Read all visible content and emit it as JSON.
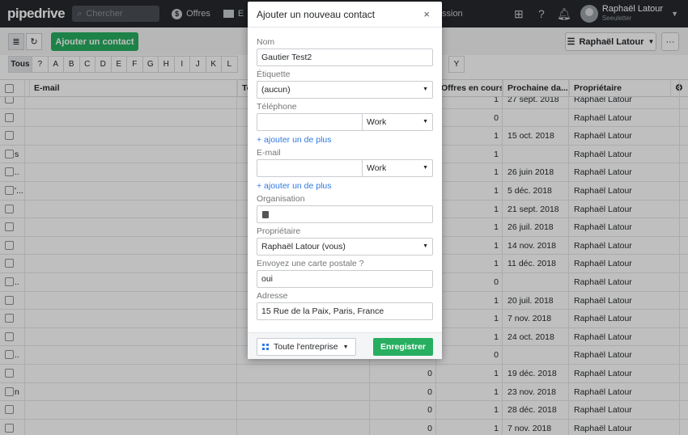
{
  "app": {
    "logo": "pipedrive",
    "search_placeholder": "Chercher",
    "nav_deals": "Offres",
    "nav_mail": "E",
    "nav_session": "ssion"
  },
  "user": {
    "name": "Raphaël Latour",
    "company": "Seeuletter"
  },
  "toolbar": {
    "add_contact": "Ajouter un contact",
    "owner_filter": "Raphaël Latour",
    "more": "···"
  },
  "alphabet": {
    "first": "Tous",
    "letters": [
      "?",
      "A",
      "B",
      "C",
      "D",
      "E",
      "F",
      "G",
      "H",
      "I",
      "J",
      "K",
      "L"
    ],
    "last": "Y"
  },
  "table": {
    "headers": {
      "email": "E-mail",
      "phone": "Te",
      "open_deals": "Offres en cours",
      "next_activity": "Prochaine da...",
      "owner": "Propriétaire"
    },
    "rows": [
      {
        "lead": "",
        "open": "1",
        "next": "27 sept. 2018",
        "owner": "Raphaël Latour"
      },
      {
        "lead": "",
        "open": "0",
        "next": "",
        "owner": "Raphaël Latour"
      },
      {
        "lead": "",
        "open": "1",
        "next": "15 oct. 2018",
        "owner": "Raphaël Latour"
      },
      {
        "lead": "s",
        "open": "1",
        "next": "",
        "owner": "Raphaël Latour"
      },
      {
        "lead": "..",
        "open": "1",
        "next": "26 juin 2018",
        "owner": "Raphaël Latour"
      },
      {
        "lead": "'...",
        "open": "1",
        "next": "5 déc. 2018",
        "owner": "Raphaël Latour"
      },
      {
        "lead": "",
        "open": "1",
        "next": "21 sept. 2018",
        "owner": "Raphaël Latour"
      },
      {
        "lead": "",
        "open": "1",
        "next": "26 juil. 2018",
        "owner": "Raphaël Latour"
      },
      {
        "lead": "",
        "open": "1",
        "next": "14 nov. 2018",
        "owner": "Raphaël Latour"
      },
      {
        "lead": "",
        "open": "1",
        "next": "11 déc. 2018",
        "owner": "Raphaël Latour"
      },
      {
        "lead": "..",
        "open": "0",
        "next": "",
        "owner": "Raphaël Latour"
      },
      {
        "lead": "",
        "open": "1",
        "next": "20 juil. 2018",
        "owner": "Raphaël Latour"
      },
      {
        "lead": "",
        "open": "1",
        "next": "7 nov. 2018",
        "owner": "Raphaël Latour"
      },
      {
        "lead": "",
        "open": "1",
        "next": "24 oct. 2018",
        "owner": "Raphaël Latour"
      },
      {
        "lead": "..",
        "open": "0",
        "next": "",
        "owner": "Raphaël Latour"
      },
      {
        "lead": "",
        "open": "1",
        "next": "19 déc. 2018",
        "owner": "Raphaël Latour"
      },
      {
        "lead": "n",
        "open": "1",
        "next": "23 nov. 2018",
        "owner": "Raphaël Latour"
      },
      {
        "lead": "",
        "open": "1",
        "next": "28 déc. 2018",
        "owner": "Raphaël Latour"
      },
      {
        "lead": "",
        "open": "1",
        "next": "7 nov. 2018",
        "owner": "Raphaël Latour"
      }
    ],
    "row_zero_col": "0"
  },
  "modal": {
    "title": "Ajouter un nouveau contact",
    "close": "×",
    "name_label": "Nom",
    "name_value": "Gautier Test2",
    "tag_label": "Étiquette",
    "tag_value": "(aucun)",
    "phone_label": "Téléphone",
    "phone_type": "Work",
    "add_more": "+ ajouter un de plus",
    "email_label": "E-mail",
    "email_type": "Work",
    "org_label": "Organisation",
    "owner_label": "Propriétaire",
    "owner_value": "Raphaël Latour (vous)",
    "postcard_label": "Envoyez une carte postale ?",
    "postcard_value": "oui",
    "address_label": "Adresse",
    "address_value": "15 Rue de la Paix, Paris, France",
    "visibility": "Toute l'entreprise",
    "save": "Enregistrer"
  }
}
